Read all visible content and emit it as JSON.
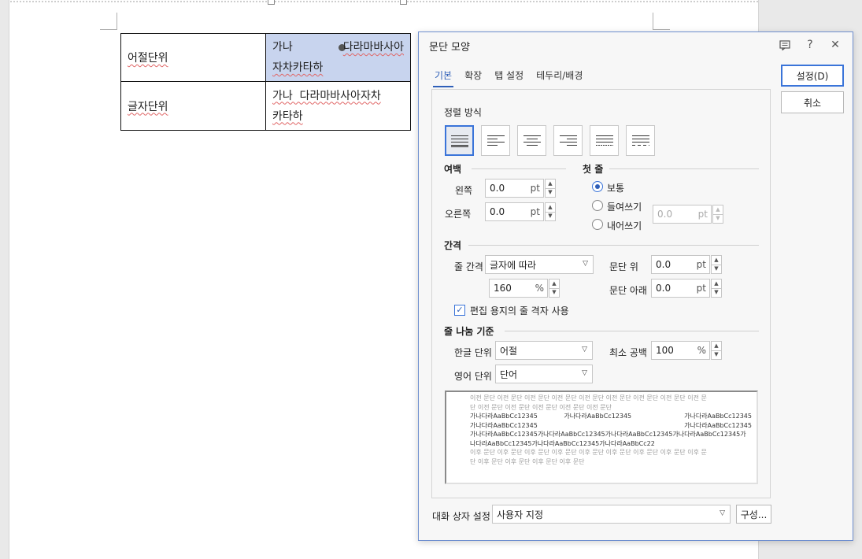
{
  "document": {
    "table": [
      {
        "label": "어절단위",
        "content_part1": "가나",
        "content_part2": "다라마바사아",
        "content_line2": "자차카타하"
      },
      {
        "label": "글자단위",
        "content_line1": "가나  다라마바사아자차",
        "content_line2": "카타하"
      }
    ]
  },
  "dialog": {
    "title": "문단 모양",
    "icons": [
      "comment-icon",
      "help-icon",
      "close-icon"
    ],
    "tabs": [
      {
        "label": "기본",
        "active": true
      },
      {
        "label": "확장",
        "active": false
      },
      {
        "label": "탭 설정",
        "active": false
      },
      {
        "label": "테두리/배경",
        "active": false
      }
    ],
    "alignment": {
      "label": "정렬 방식",
      "options": [
        "justify",
        "left",
        "center",
        "right",
        "distribute",
        "split"
      ],
      "selected": "justify"
    },
    "margin": {
      "label": "여백",
      "left": {
        "label": "왼쪽",
        "value": "0.0",
        "unit": "pt"
      },
      "right": {
        "label": "오른쪽",
        "value": "0.0",
        "unit": "pt"
      }
    },
    "first_line": {
      "label": "첫 줄",
      "options": [
        {
          "label": "보통",
          "checked": true
        },
        {
          "label": "들여쓰기",
          "checked": false
        },
        {
          "label": "내어쓰기",
          "checked": false
        }
      ],
      "value": "0.0",
      "unit": "pt"
    },
    "spacing": {
      "label": "간격",
      "line_spacing_label": "줄 간격",
      "line_spacing_type": "글자에 따라",
      "line_spacing_value": "160",
      "line_spacing_unit": "%",
      "above_label": "문단 위",
      "above_value": "0.0",
      "above_unit": "pt",
      "below_label": "문단 아래",
      "below_value": "0.0",
      "below_unit": "pt",
      "grid_checkbox_label": "편집 용지의 줄 격자 사용",
      "grid_checked": true
    },
    "line_break": {
      "label": "줄 나눔 기준",
      "hangul_label": "한글 단위",
      "hangul_value": "어절",
      "english_label": "영어 단위",
      "english_value": "단어",
      "min_space_label": "최소 공백",
      "min_space_value": "100",
      "min_space_unit": "%"
    },
    "preview": {
      "prev_line1": "이전 문단 이전 문단 이전 문단 이전 문단 이전 문단 이전 문단 이전 문단 이전 문단 이전 문",
      "prev_line2": "단 이전 문단 이전 문단 이전 문단 이전 문단 이전 문단",
      "sample_a": "가나다라AaBbCc12345",
      "sample_b": "가나다라AaBbCc12345",
      "sample_c": "가나다라AaBbCc12345",
      "sample_d": "가나다라AaBbCc12345",
      "sample_e": "가나다라AaBbCc12345",
      "sample_long1": "가나다라AaBbCc12345가나다라AaBbCc12345가나다라AaBbCc12345가나다라AaBbCc12345가",
      "sample_long2": "나다라AaBbCc12345가나다라AaBbCc12345가나다라AaBbCc22",
      "next_line1": "이후 문단 이후 문단 이후 문단 이후 문단 이후 문단 이후 문단 이후 문단 이후 문단 이후 문",
      "next_line2": "단 이후 문단 이후 문단 이후 문단 이후 문단"
    },
    "buttons": {
      "ok": "설정(D)",
      "cancel": "취소",
      "config": "구성..."
    },
    "dialog_setting": {
      "label": "대화 상자 설정",
      "value": "사용자 지정"
    }
  },
  "colors": {
    "accent": "#2f5fb8",
    "selection": "#c8d4ee",
    "dialog_border": "#6f8fcf"
  }
}
